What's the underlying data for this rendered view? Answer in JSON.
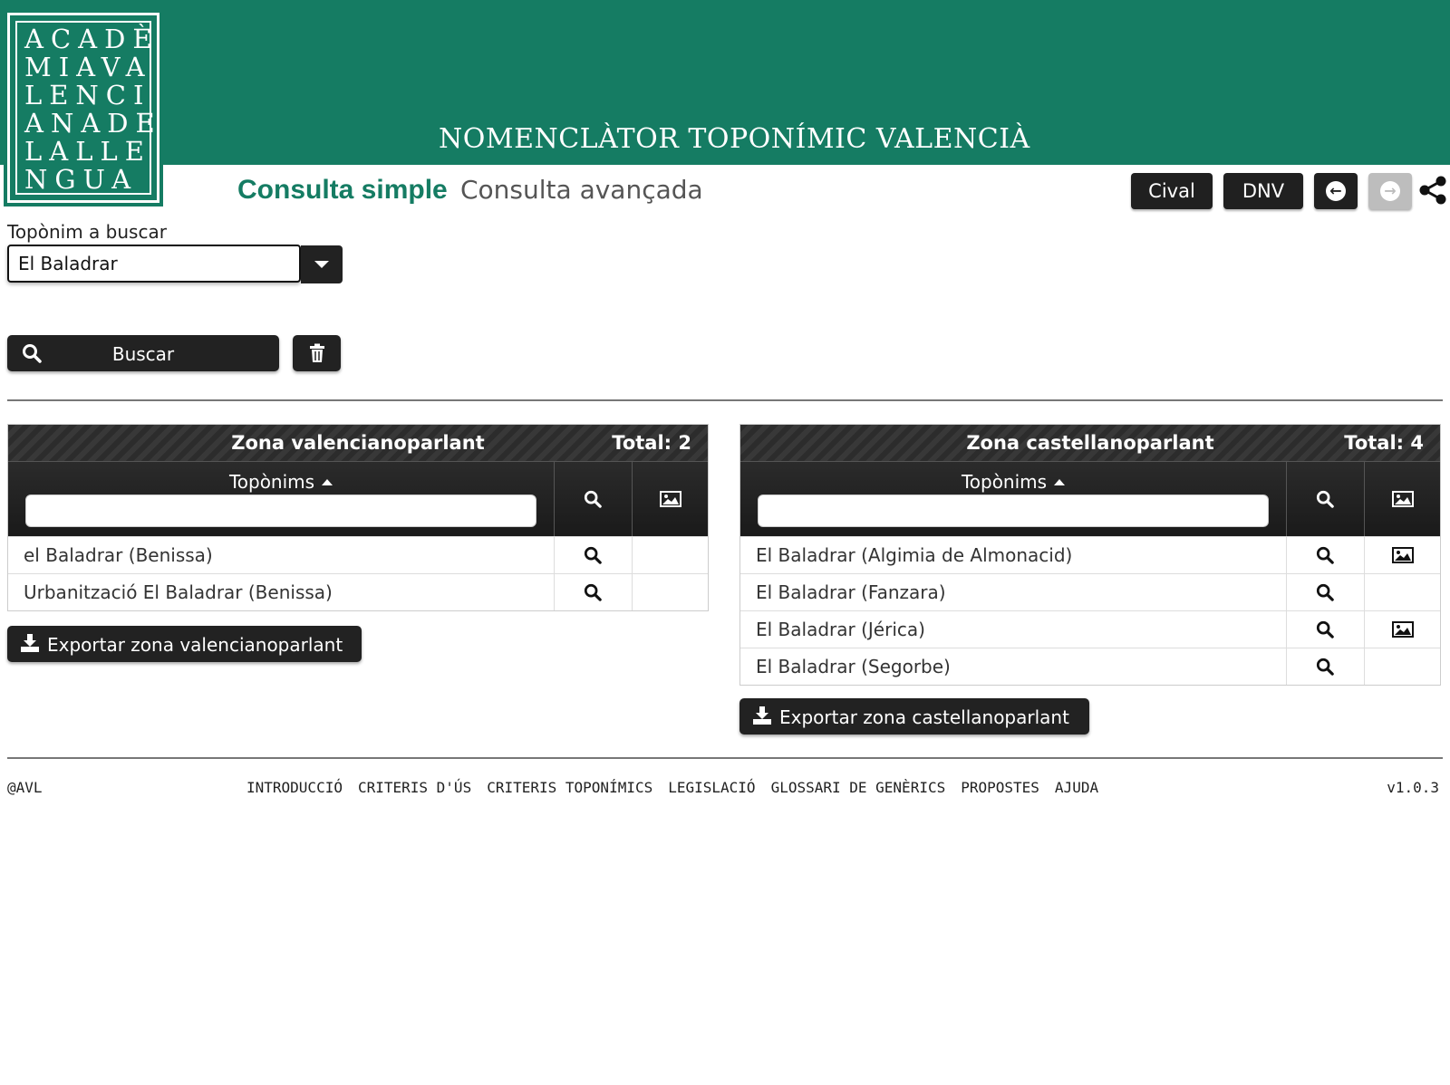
{
  "logo": {
    "lines": [
      "ACADÈ",
      "MIAVA",
      "LENCI",
      "ANADE",
      "LALLE",
      "NGUA"
    ]
  },
  "header": {
    "title": "NOMENCLÀTOR TOPONÍMIC VALENCIÀ"
  },
  "tabs": {
    "simple": "Consulta simple",
    "advanced": "Consulta avançada"
  },
  "toolbar": {
    "cival": "Cival",
    "dnv": "DNV"
  },
  "search": {
    "label": "Topònim a buscar",
    "value": "El Baladrar",
    "button": "Buscar"
  },
  "zones": [
    {
      "title": "Zona valencianoparlant",
      "total": "Total: 2",
      "column": "Topònims",
      "rows": [
        {
          "name": "el Baladrar (Benissa)",
          "has_image": false
        },
        {
          "name": "Urbanització El Baladrar (Benissa)",
          "has_image": false
        }
      ],
      "export": "Exportar zona valencianoparlant"
    },
    {
      "title": "Zona castellanoparlant",
      "total": "Total: 4",
      "column": "Topònims",
      "rows": [
        {
          "name": "El Baladrar (Algimia de Almonacid)",
          "has_image": true
        },
        {
          "name": "El Baladrar (Fanzara)",
          "has_image": false
        },
        {
          "name": "El Baladrar (Jérica)",
          "has_image": true
        },
        {
          "name": "El Baladrar (Segorbe)",
          "has_image": false
        }
      ],
      "export": "Exportar zona castellanoparlant"
    }
  ],
  "footer": {
    "copyright": "@AVL",
    "links": [
      "INTRODUCCIÓ",
      "CRITERIS D'ÚS",
      "CRITERIS TOPONÍMICS",
      "LEGISLACIÓ",
      "GLOSSARI DE GENÈRICS",
      "PROPOSTES",
      "AJUDA"
    ],
    "version": "v1.0.3"
  },
  "colors": {
    "brand": "#157c63",
    "dark_button": "#222222",
    "disabled_button": "#bdbdbd"
  },
  "icons": {
    "search": "search-icon",
    "trash": "trash-icon",
    "image": "image-icon",
    "download": "download-icon",
    "share": "share-icon",
    "back": "arrow-left-icon",
    "forward": "arrow-right-icon",
    "dropdown": "chevron-down-icon"
  }
}
